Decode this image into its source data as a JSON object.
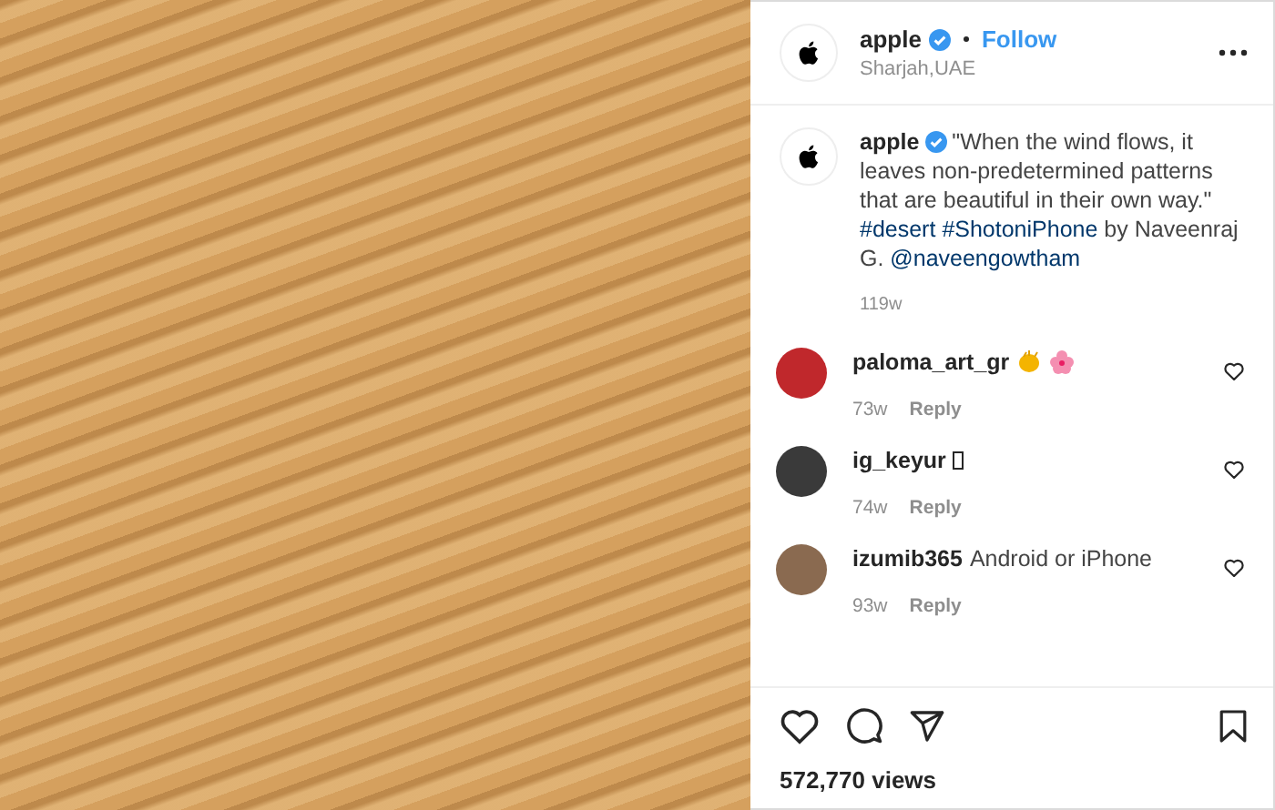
{
  "post": {
    "author": "apple",
    "follow": "Follow",
    "location": "Sharjah,UAE"
  },
  "caption": {
    "author": "apple",
    "segments": [
      {
        "kind": "text",
        "text": "\"When the wind flows, it leaves non-predetermined patterns that are beautiful in their own way.\" "
      },
      {
        "kind": "link",
        "text": "#desert"
      },
      {
        "kind": "link",
        "text": "#ShotoniPhone"
      },
      {
        "kind": "text",
        "text": " by Naveenraj G. "
      },
      {
        "kind": "link",
        "text": "@naveengowtham"
      }
    ],
    "age": "119w"
  },
  "comments": [
    {
      "user": "paloma_art_gr",
      "kind": "emoji",
      "age": "73w",
      "reply": "Reply"
    },
    {
      "user": "ig_keyur",
      "kind": "glyph",
      "age": "74w",
      "reply": "Reply"
    },
    {
      "user": "izumib365",
      "text": "Android or iPhone",
      "kind": "text",
      "age": "93w",
      "reply": "Reply"
    }
  ],
  "views": "572,770 views"
}
